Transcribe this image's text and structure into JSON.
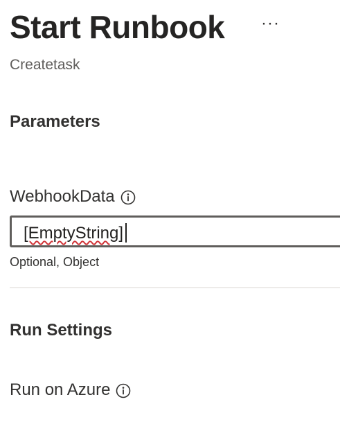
{
  "header": {
    "title": "Start Runbook",
    "more_label": "···",
    "subtitle": "Createtask"
  },
  "parameters": {
    "section_title": "Parameters",
    "webhook": {
      "label": "WebhookData",
      "value": "[EmptyString]",
      "hint": "Optional, Object"
    }
  },
  "run_settings": {
    "section_title": "Run Settings",
    "run_on_label": "Run on Azure"
  },
  "icons": {
    "info": "info-icon",
    "more": "more-icon"
  },
  "colors": {
    "text": "#323130",
    "secondary_text": "#605e5c",
    "input_border": "#605e5c",
    "spellcheck": "#d13438",
    "divider": "#edebe9"
  }
}
